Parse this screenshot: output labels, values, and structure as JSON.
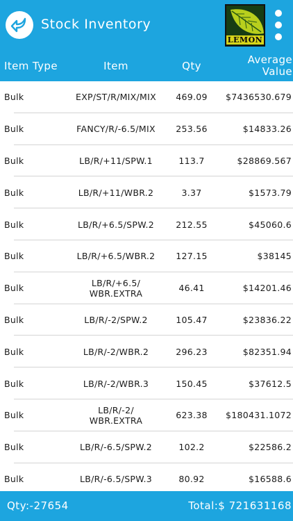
{
  "header": {
    "title": "Stock Inventory",
    "back_icon": "back-arrow-icon",
    "menu_icon": "more-vertical-icon",
    "logo_text": "LEMON",
    "accent_color": "#1da5df"
  },
  "table": {
    "columns": {
      "type": "Item Type",
      "item": "Item",
      "qty": "Qty",
      "avg_line1": "Average",
      "avg_line2": "Value"
    },
    "rows": [
      {
        "type": "Bulk",
        "item": "EXP/ST/R/MIX/MIX",
        "qty": "469.09",
        "avg": "$7436530.679"
      },
      {
        "type": "Bulk",
        "item": "FANCY/R/-6.5/MIX",
        "qty": "253.56",
        "avg": "$14833.26"
      },
      {
        "type": "Bulk",
        "item": "LB/R/+11/SPW.1",
        "qty": "113.7",
        "avg": "$28869.567"
      },
      {
        "type": "Bulk",
        "item": "LB/R/+11/WBR.2",
        "qty": "3.37",
        "avg": "$1573.79"
      },
      {
        "type": "Bulk",
        "item": "LB/R/+6.5/SPW.2",
        "qty": "212.55",
        "avg": "$45060.6"
      },
      {
        "type": "Bulk",
        "item": "LB/R/+6.5/WBR.2",
        "qty": "127.15",
        "avg": "$38145"
      },
      {
        "type": "Bulk",
        "item": "LB/R/+6.5/ WBR.EXTRA",
        "qty": "46.41",
        "avg": "$14201.46"
      },
      {
        "type": "Bulk",
        "item": "LB/R/-2/SPW.2",
        "qty": "105.47",
        "avg": "$23836.22"
      },
      {
        "type": "Bulk",
        "item": "LB/R/-2/WBR.2",
        "qty": "296.23",
        "avg": "$82351.94"
      },
      {
        "type": "Bulk",
        "item": "LB/R/-2/WBR.3",
        "qty": "150.45",
        "avg": "$37612.5"
      },
      {
        "type": "Bulk",
        "item": "LB/R/-2/ WBR.EXTRA",
        "qty": "623.38",
        "avg": "$180431.1072"
      },
      {
        "type": "Bulk",
        "item": "LB/R/-6.5/SPW.2",
        "qty": "102.2",
        "avg": "$22586.2"
      },
      {
        "type": "Bulk",
        "item": "LB/R/-6.5/SPW.3",
        "qty": "80.92",
        "avg": "$16588.6"
      }
    ]
  },
  "footer": {
    "qty": "Qty:-27654",
    "total": "Total:$ 721631168"
  }
}
